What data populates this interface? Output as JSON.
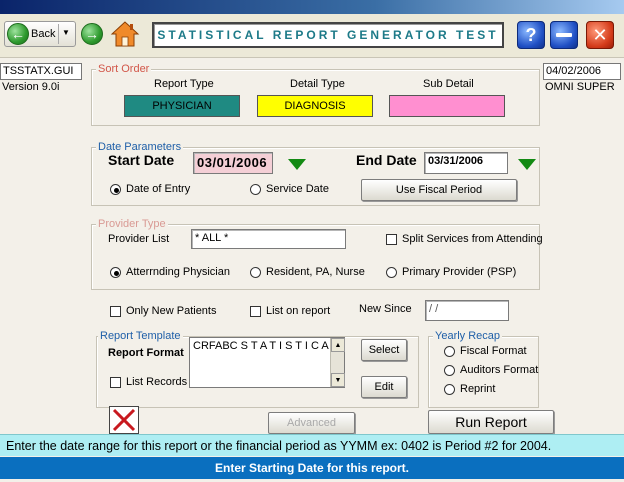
{
  "toolbar": {
    "back_label": "Back",
    "title": "STATISTICAL REPORT GENERATOR  TEST",
    "help_glyph": "?",
    "close_glyph": "✕"
  },
  "info": {
    "program": "TSSTATX.GUI",
    "version": "Version 9.0i",
    "date": "04/02/2006",
    "user": "OMNI SUPER"
  },
  "sort_order": {
    "legend": "Sort Order",
    "report_type_label": "Report Type",
    "detail_type_label": "Detail Type",
    "sub_detail_label": "Sub Detail",
    "report_type_value": "PHYSICIAN",
    "detail_type_value": "DIAGNOSIS",
    "sub_detail_value": "",
    "colors": {
      "report": "#1f8a82",
      "detail": "#ffff00",
      "sub": "#ff8fd0"
    }
  },
  "date_params": {
    "legend": "Date Parameters",
    "start_label": "Start Date",
    "start_value": "03/01/2006",
    "end_label": "End Date",
    "end_value": "03/31/2006",
    "entry_label": "Date of Entry",
    "service_label": "Service Date",
    "fiscal_button": "Use Fiscal Period"
  },
  "provider": {
    "legend": "Provider Type",
    "list_label": "Provider List",
    "list_value": "* ALL *",
    "split_label": "Split Services from Attending",
    "attending_label": "Atterrnding Physician",
    "resident_label": "Resident, PA, Nurse",
    "primary_label": "Primary Provider (PSP)"
  },
  "options": {
    "only_new_label": "Only New Patients",
    "list_on_report_label": "List on report",
    "new_since_label": "New Since",
    "new_since_value": " /  /"
  },
  "template": {
    "legend": "Report Template",
    "format_label": "Report Format",
    "format_value": "CRFABC S T A T I S T I C A L",
    "list_records_label": "List Records",
    "select_button": "Select",
    "edit_button": "Edit"
  },
  "recap": {
    "legend": "Yearly Recap",
    "fiscal_label": "Fiscal Format",
    "auditors_label": "Auditors Format",
    "reprint_label": "Reprint"
  },
  "actions": {
    "advanced_button": "Advanced",
    "run_button": "Run Report"
  },
  "hint_text": "Enter the date range for this report or the financial period as YYMM ex: 0402 is Period #2 for 2004.",
  "status_text": "Enter Starting Date for this report."
}
